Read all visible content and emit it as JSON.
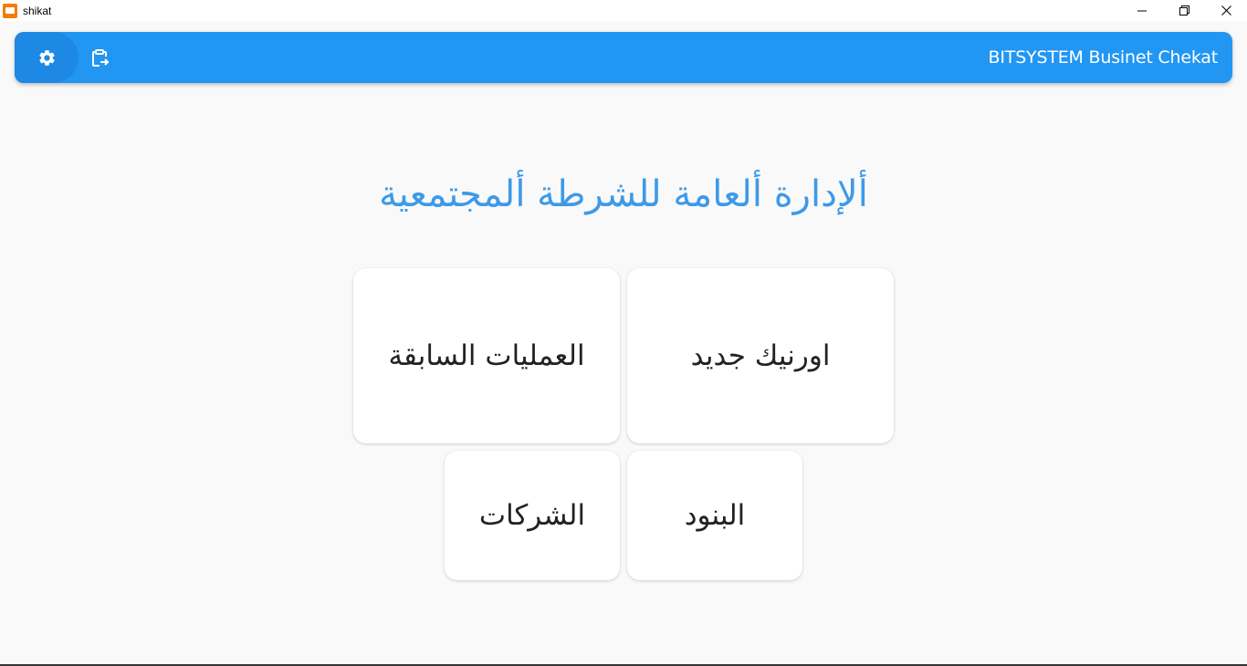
{
  "window": {
    "title": "shikat",
    "icon": "app-icon",
    "controls": [
      "minimize-icon",
      "restore-icon",
      "close-icon"
    ]
  },
  "appbar": {
    "title": "BITSYSTEM Businet Chekat",
    "background": "#2196f3",
    "actions": [
      "gear-icon",
      "export-clipboard-icon"
    ]
  },
  "main": {
    "heading": "ألإدارة ألعامة للشرطة ألمجتمعية",
    "heading_color": "#3d9ae8",
    "cards": [
      {
        "label": "اورنيك جديد"
      },
      {
        "label": "العمليات السابقة"
      },
      {
        "label": "البنود"
      },
      {
        "label": "الشركات"
      }
    ]
  }
}
